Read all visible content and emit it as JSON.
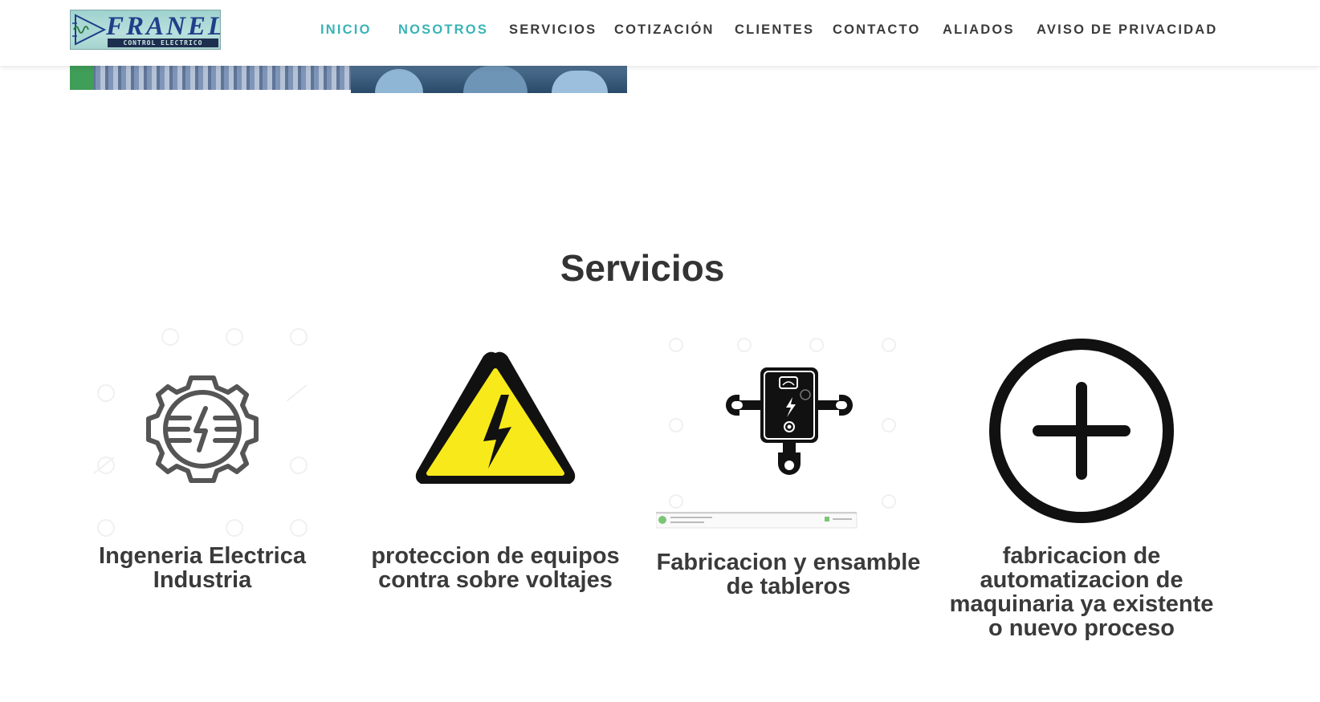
{
  "header": {
    "logo": {
      "name": "FRANEL",
      "tagline": "CONTROL ELECTRICO"
    },
    "nav": [
      {
        "label": "INICIO",
        "active": true
      },
      {
        "label": "NOSOTROS",
        "active": true
      },
      {
        "label": "SERVICIOS",
        "active": false
      },
      {
        "label": "COTIZACIÓN",
        "active": false
      },
      {
        "label": "CLIENTES",
        "active": false
      },
      {
        "label": "CONTACTO",
        "active": false
      },
      {
        "label": "ALIADOS",
        "active": false
      },
      {
        "label": "AVISO DE PRIVACIDAD",
        "active": false
      }
    ]
  },
  "main": {
    "section_title": "Servicios",
    "services": [
      {
        "title_line1": "Ingeneria Electrica",
        "title_line2": "Industria",
        "title_line3": "",
        "title_line4": "",
        "icon": "gear-lightning-icon"
      },
      {
        "title_line1": "proteccion de equipos",
        "title_line2": "contra sobre voltajes",
        "title_line3": "",
        "title_line4": "",
        "icon": "high-voltage-warning-icon"
      },
      {
        "title_line1": "Fabricacion y ensamble",
        "title_line2": "de tableros",
        "title_line3": "",
        "title_line4": "",
        "icon": "electrical-panel-icon"
      },
      {
        "title_line1": "fabricacion de",
        "title_line2": "automatizacion de",
        "title_line3": "maquinaria ya existente",
        "title_line4": "o nuevo proceso",
        "icon": "plus-circle-icon"
      }
    ]
  },
  "colors": {
    "nav_active": "#3ab3b6",
    "nav_default": "#3b3b3b",
    "title_text": "#333333",
    "warning_yellow": "#f7e91a"
  }
}
